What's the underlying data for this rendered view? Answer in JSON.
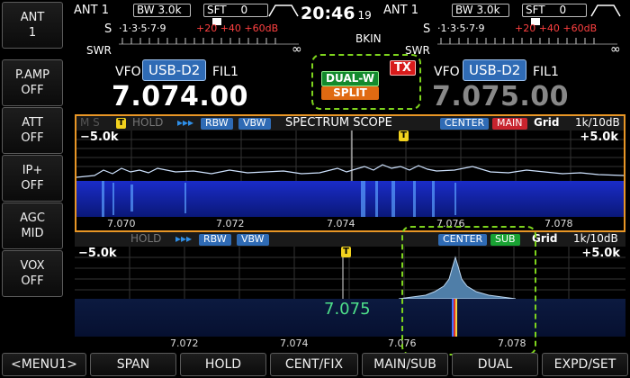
{
  "sidebar": {
    "buttons": [
      {
        "label": "ANT",
        "value": "1"
      },
      {
        "label": "P.AMP",
        "value": "OFF"
      },
      {
        "label": "ATT",
        "value": "OFF"
      },
      {
        "label": "IP+",
        "value": "OFF"
      },
      {
        "label": "AGC",
        "value": "MID"
      },
      {
        "label": "VOX",
        "value": "OFF"
      }
    ]
  },
  "header": {
    "main": {
      "ant": "ANT 1",
      "bw": "BW 3.0k",
      "sft_label": "SFT",
      "sft_value": "0"
    },
    "sub": {
      "ant": "ANT 1",
      "bw": "BW 3.0k",
      "sft_label": "SFT",
      "sft_value": "0"
    },
    "time": "20:46",
    "seconds": "19",
    "bkin": "BKIN"
  },
  "smeter": {
    "s_label": "S",
    "swr_label": "SWR",
    "scale": "·1·3·5·7·9",
    "plus_scale": "+20 +40 +60dB",
    "swr_scale": "1   1.5  2  3",
    "inf": "∞"
  },
  "vfo": {
    "main": {
      "label": "VFO",
      "mode": "USB-D2",
      "filter": "FIL1",
      "freq": "7.074.00"
    },
    "sub": {
      "label": "VFO",
      "mode": "USB-D2",
      "filter": "FIL1",
      "freq": "7.075.00"
    }
  },
  "tags": {
    "dual": "DUAL-W",
    "split": "SPLIT",
    "tx": "TX"
  },
  "scope_main": {
    "ms": "M  S",
    "t": "T",
    "hold": "HOLD",
    "arrows": "▸▸▸",
    "rbw": "RBW",
    "vbw": "VBW",
    "title": "SPECTRUM SCOPE",
    "center": "CENTER",
    "main": "MAIN",
    "grid": "Grid",
    "ref": "1k/10dB",
    "left_edge": "−5.0k",
    "right_edge": "+5.0k",
    "ticks": [
      "7.070",
      "7.072",
      "7.074",
      "7.076",
      "7.078"
    ]
  },
  "scope_sub": {
    "hold": "HOLD",
    "arrows": "▸▸▸",
    "rbw": "RBW",
    "vbw": "VBW",
    "center": "CENTER",
    "sub": "SUB",
    "grid": "Grid",
    "ref": "1k/10dB",
    "left_edge": "−5.0k",
    "right_edge": "+5.0k",
    "marker_freq": "7.075",
    "t": "T",
    "ticks": [
      "7.072",
      "7.074",
      "7.076",
      "7.078"
    ]
  },
  "bottom": {
    "buttons": [
      "<MENU1>",
      "SPAN",
      "HOLD",
      "CENT/FIX",
      "MAIN/SUB",
      "DUAL",
      "EXPD/SET"
    ]
  },
  "colors": {
    "accent_blue": "#2f6bb5",
    "highlight_green": "#7dd31d",
    "scope_border": "#e89626",
    "tx_red": "#d81b1b",
    "split_orange": "#e06a12"
  }
}
